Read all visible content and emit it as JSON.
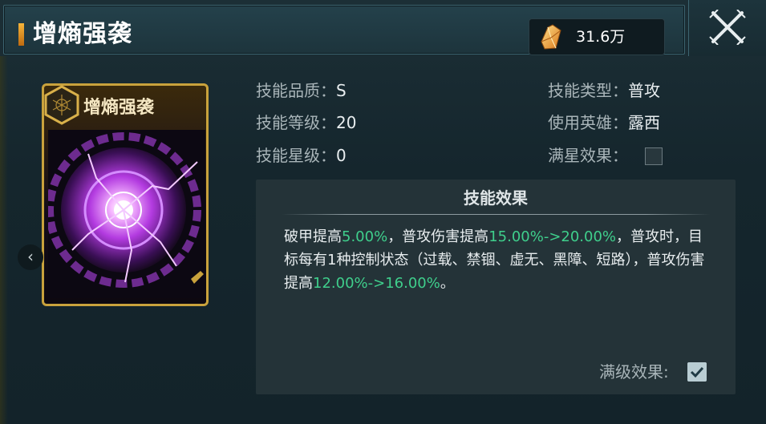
{
  "window": {
    "title": "增熵强袭",
    "currency_value": "31.6万"
  },
  "card": {
    "name": "增熵强袭"
  },
  "skill_info": {
    "quality_label": "技能品质：",
    "quality_value": "S",
    "level_label": "技能等级：",
    "level_value": "20",
    "star_label": "技能星级：",
    "star_value": "0",
    "type_label": "技能类型：",
    "type_value": "普攻",
    "hero_label": "使用英雄：",
    "hero_value": "露西",
    "max_star_label": "满星效果："
  },
  "effect": {
    "heading": "技能效果",
    "seg1": "破甲提高",
    "seg2": "5.00%",
    "seg3": "，普攻伤害提高",
    "seg4": "15.00%->20.00%",
    "seg5": "，普攻时，目标每有1种控制状态（过载、禁锢、虚无、黑障、短路），普攻伤害提高",
    "seg6": "12.00%->16.00%",
    "seg7": "。",
    "max_level_label": "满级效果:"
  },
  "colors": {
    "highlight": "#3fcf8c",
    "accent_gold": "#c9a23c"
  },
  "icons": {
    "currency": "crystal-icon",
    "close": "crossed-swords-close-icon",
    "prev": "chevron-left-icon"
  }
}
